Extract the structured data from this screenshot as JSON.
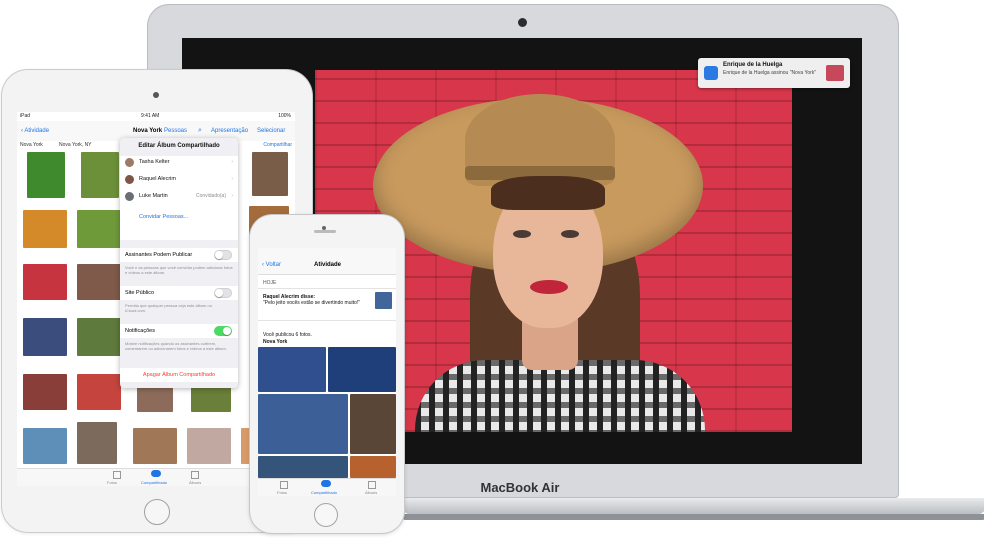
{
  "mac": {
    "brand": "MacBook Air",
    "notification": {
      "title": "Enrique de la Huelga",
      "body": "Enrique de la Huelga assinou \"Nova York\""
    }
  },
  "ipad": {
    "status": {
      "carrier": "iPad",
      "time": "9:41 AM",
      "battery": "100%"
    },
    "nav": {
      "back_label": "Atividade",
      "title": "Nova York",
      "people_label": "Pessoas",
      "presentation_label": "Apresentação",
      "select_label": "Selecionar"
    },
    "subnav": {
      "album": "Nova York",
      "location": "Nova York, NY",
      "share_label": "Compartilhar"
    },
    "popover": {
      "title": "Editar Álbum Compartilhado",
      "people": [
        "Tasha Kelter",
        "Raquel Alecrim",
        "Luke Martin"
      ],
      "invited_status": "Convidado(a)",
      "invite_label": "Convidar Pessoas...",
      "subscribers_post_label": "Assinantes Podem Publicar",
      "subscribers_post_note": "Você e as pessoas que você convidar podem adicionar fotos e vídeos a este álbum.",
      "subscribers_post_on": false,
      "public_site_label": "Site Público",
      "public_site_note": "Permita que qualquer pessoa veja este álbum no iCloud.com.",
      "public_site_on": false,
      "notifications_label": "Notificações",
      "notifications_note": "Mostre notificações quando os assinantes curtirem, comentarem ou adicionarem fotos e vídeos a este álbum.",
      "notifications_on": true,
      "delete_label": "Apagar Álbum Compartilhado"
    },
    "tabbar": [
      "Fotos",
      "Compartilhado",
      "Álbuns"
    ],
    "colors": {
      "accent": "#1f74e6",
      "destructive": "#ff3b30",
      "toggle_on": "#4cd964"
    }
  },
  "iphone": {
    "nav": {
      "back_label": "Voltar",
      "title": "Atividade"
    },
    "section": "HOJE",
    "comment_author": "Raquel Alecrim disse:",
    "comment_text": "\"Pelo jeito vocês estão se divertindo muito!\"",
    "post_text": "Você publicou 6 fotos.",
    "post_album": "Nova York",
    "tabbar": [
      "Fotos",
      "Compartilhado",
      "Álbuns"
    ]
  }
}
